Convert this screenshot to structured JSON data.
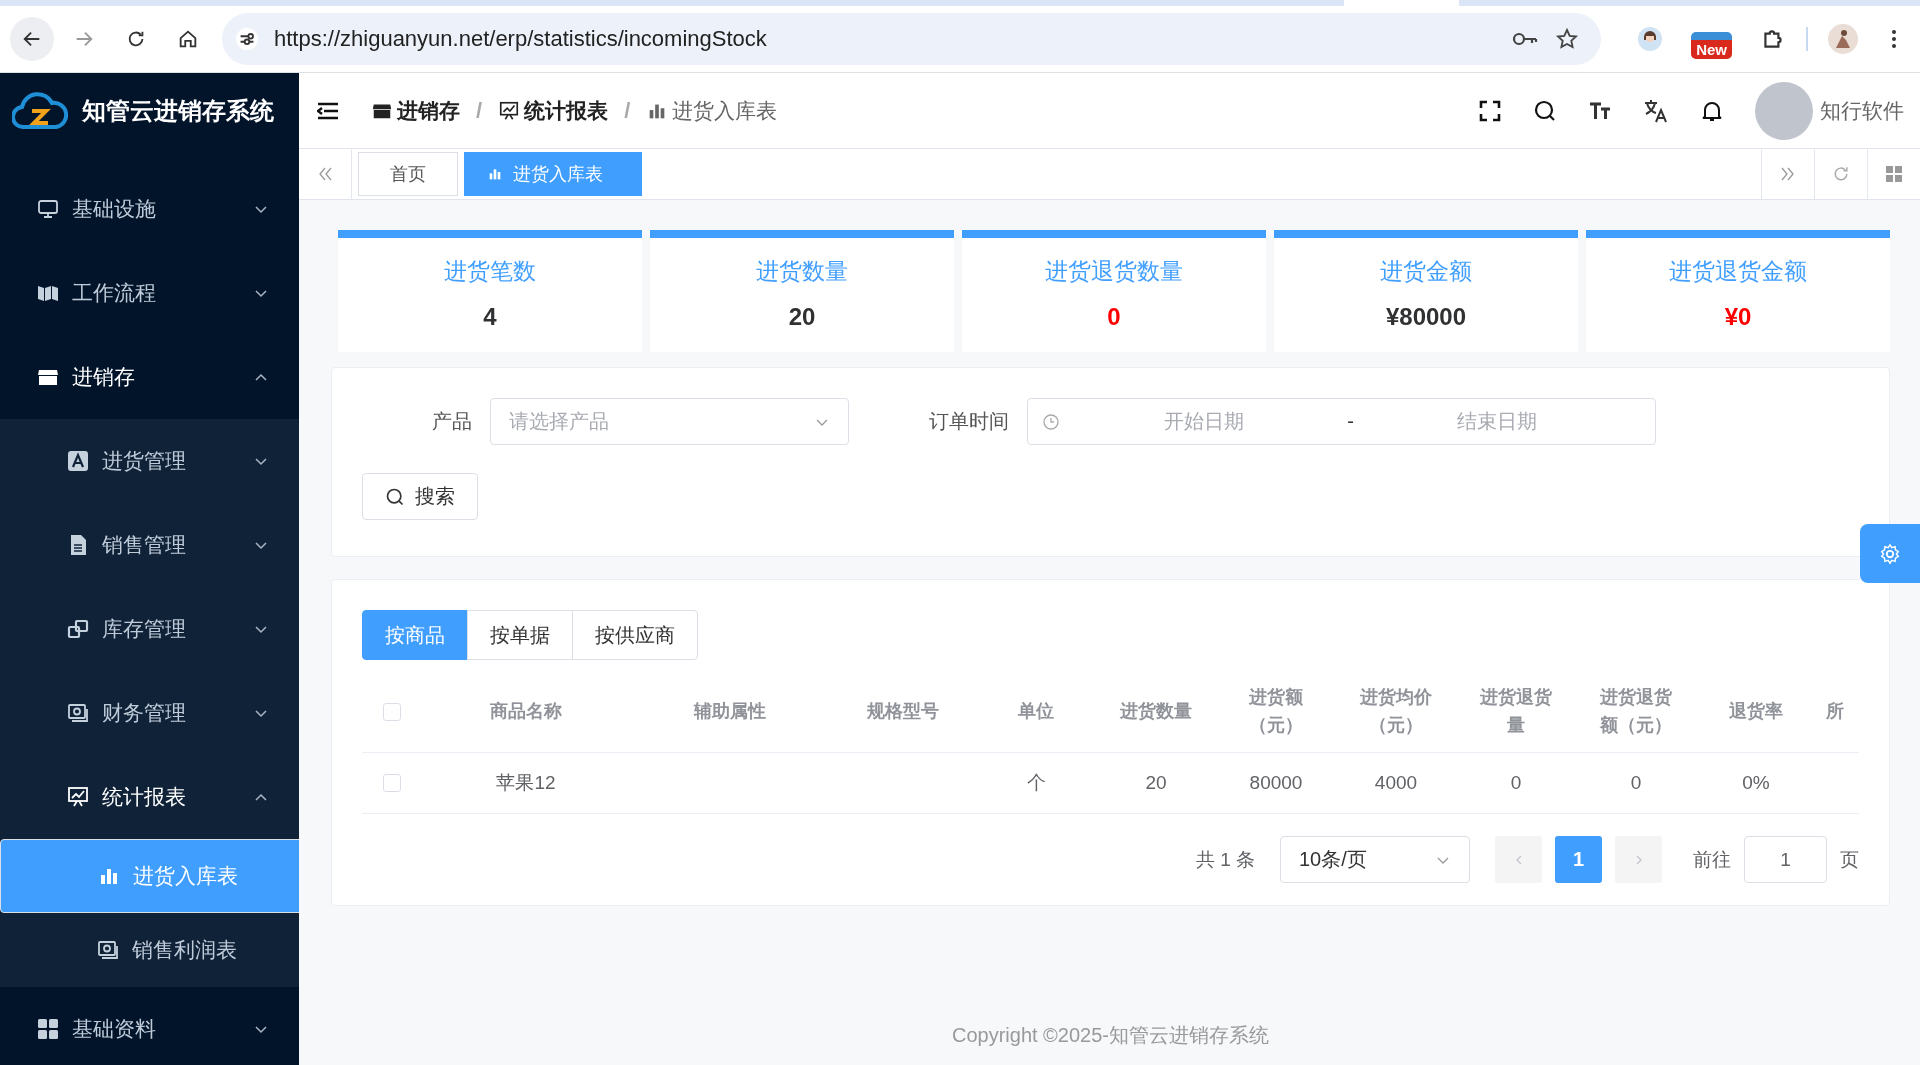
{
  "browser": {
    "url": "https://zhiguanyun.net/erp/statistics/incomingStock",
    "badge": "New"
  },
  "logo_title": "知管云进销存系统",
  "sidebar": {
    "items": [
      {
        "label": "基础设施",
        "expanded": false,
        "selected": false
      },
      {
        "label": "工作流程",
        "expanded": false,
        "selected": false
      },
      {
        "label": "进销存",
        "expanded": true,
        "selected": false,
        "children": [
          {
            "label": "进货管理",
            "expanded": false,
            "selected": false
          },
          {
            "label": "销售管理",
            "expanded": false,
            "selected": false
          },
          {
            "label": "库存管理",
            "expanded": false,
            "selected": false
          },
          {
            "label": "财务管理",
            "expanded": false,
            "selected": false
          },
          {
            "label": "统计报表",
            "expanded": true,
            "selected": false,
            "children": [
              {
                "label": "进货入库表",
                "selected": true
              },
              {
                "label": "销售利润表",
                "selected": false
              }
            ]
          }
        ]
      },
      {
        "label": "基础资料",
        "expanded": false,
        "selected": false
      }
    ]
  },
  "breadcrumb": [
    {
      "label": "进销存",
      "current": false
    },
    {
      "separator": "/",
      "label": "统计报表",
      "current": false
    },
    {
      "separator": "/",
      "label": "进货入库表",
      "current": true
    }
  ],
  "user": {
    "name": "知行软件"
  },
  "tabs": [
    {
      "label": "首页",
      "selected": false
    },
    {
      "label": "进货入库表",
      "selected": true
    }
  ],
  "stats": [
    {
      "label": "进货笔数",
      "value": "4",
      "color": "#303133"
    },
    {
      "label": "进货数量",
      "value": "20",
      "color": "#303133"
    },
    {
      "label": "进货退货数量",
      "value": "0",
      "color": "#ff0000"
    },
    {
      "label": "进货金额",
      "value": "¥80000",
      "color": "#303133"
    },
    {
      "label": "进货退货金额",
      "value": "¥0",
      "color": "#ff0000"
    }
  ],
  "filter": {
    "fields": [
      {
        "label": "产品",
        "kind": "select",
        "placeholder": "请选择产品"
      },
      {
        "label": "订单时间",
        "kind": "daterange",
        "start_placeholder": "开始日期",
        "separator": "-",
        "end_placeholder": "结束日期"
      }
    ],
    "search_button": "搜索"
  },
  "table": {
    "view_tabs": [
      {
        "label": "按商品",
        "selected": true
      },
      {
        "label": "按单据",
        "selected": false
      },
      {
        "label": "按供应商",
        "selected": false
      }
    ],
    "header_checked": false,
    "columns": [
      {
        "label": "商品名称"
      },
      {
        "label": "辅助属性"
      },
      {
        "label": "规格型号"
      },
      {
        "label": "单位"
      },
      {
        "label": "进货数量"
      },
      {
        "label": "进货额（元）"
      },
      {
        "label": "进货均价（元）"
      },
      {
        "label": "进货退货量"
      },
      {
        "label": "进货退货额（元）"
      },
      {
        "label": "退货率"
      },
      {
        "label": "所"
      }
    ],
    "rows": [
      {
        "checked": false,
        "cells": [
          "苹果12",
          "",
          "",
          "个",
          "20",
          "80000",
          "4000",
          "0",
          "0",
          "0%",
          ""
        ]
      }
    ]
  },
  "pagination": {
    "total": "共 1 条",
    "page_size": "10条/页",
    "pages": [
      {
        "label": "1",
        "selected": true
      }
    ],
    "goto_label": "前往",
    "goto_value": "1",
    "page_suffix": "页"
  },
  "footer": {
    "copyright": "Copyright ©2025-知管云进销存系统"
  }
}
